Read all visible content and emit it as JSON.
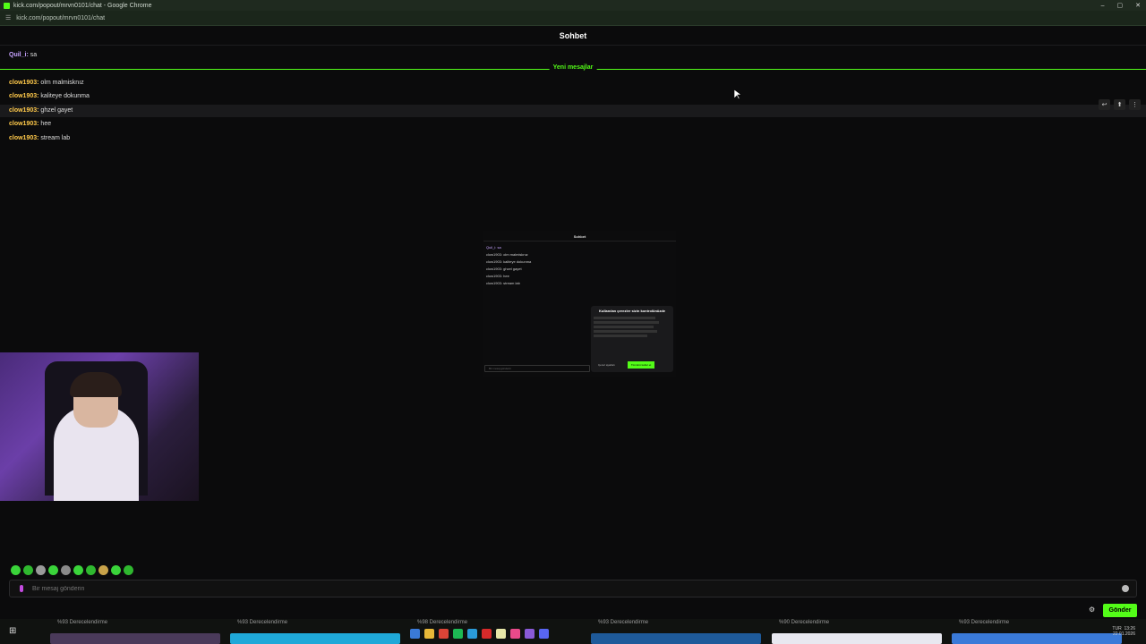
{
  "browser": {
    "title": "kick.com/popout/mrvn0101/chat - Google Chrome",
    "url": "kick.com/popout/mrvn0101/chat",
    "controls": [
      "–",
      "▢",
      "✕"
    ]
  },
  "chat": {
    "header": "Sohbet",
    "first_message": {
      "user": "Quil_i:",
      "text": "sa",
      "color": "#c7a3ff"
    },
    "divider_label": "Yeni mesajlar",
    "messages": [
      {
        "user": "clow1903:",
        "text": "olm malmisknız",
        "color": "#ffc94a"
      },
      {
        "user": "clow1903:",
        "text": "kaliteye dokunma",
        "color": "#ffc94a"
      },
      {
        "user": "clow1903:",
        "text": "ghzel gayet",
        "color": "#ffc94a"
      },
      {
        "user": "clow1903:",
        "text": "hee",
        "color": "#ffc94a"
      },
      {
        "user": "clow1903:",
        "text": "stream lab",
        "color": "#ffc94a"
      }
    ],
    "hover_tools": [
      "reply-icon",
      "pin-icon",
      "more-icon"
    ],
    "input_placeholder": "Bir mesaj gönderin",
    "send_label": "Gönder"
  },
  "mini_preview": {
    "header": "Sohbet",
    "messages": [
      "Quil_i: sa",
      "clow1903: olm malmisknız",
      "clow1903: kaliteye dokunma",
      "clow1903: ghzel gayet",
      "clow1903: hee",
      "clow1903: stream lab"
    ],
    "input_placeholder": "Bir mesaj gönderin",
    "cookie_title": "Kullanılan çerezler sizin kontrolünüzde",
    "cookie_reject": "Çerez ayarları",
    "cookie_accept": "Tümünü kabul et"
  },
  "taskbar": {
    "tiles": [
      {
        "label": "%93 Derecelendirme",
        "color": "#c9a3a3"
      },
      {
        "label": "%93 Derecelendirme",
        "color": "#1fa8d8"
      },
      {
        "label": "%98 Derecelendirme",
        "color": "#3a7ad8"
      },
      {
        "label": "%93 Derecelendirme",
        "color": "#2a8ad8"
      },
      {
        "label": "%90 Derecelendirme",
        "color": "#e8e8f0"
      },
      {
        "label": "%93 Derecelendirme",
        "color": "#d85a5a"
      }
    ],
    "clock": "13:26",
    "date": "22.01.2026",
    "lang": "TUR"
  },
  "colors": {
    "accent": "#53fc18",
    "background": "#0b0b0c"
  }
}
